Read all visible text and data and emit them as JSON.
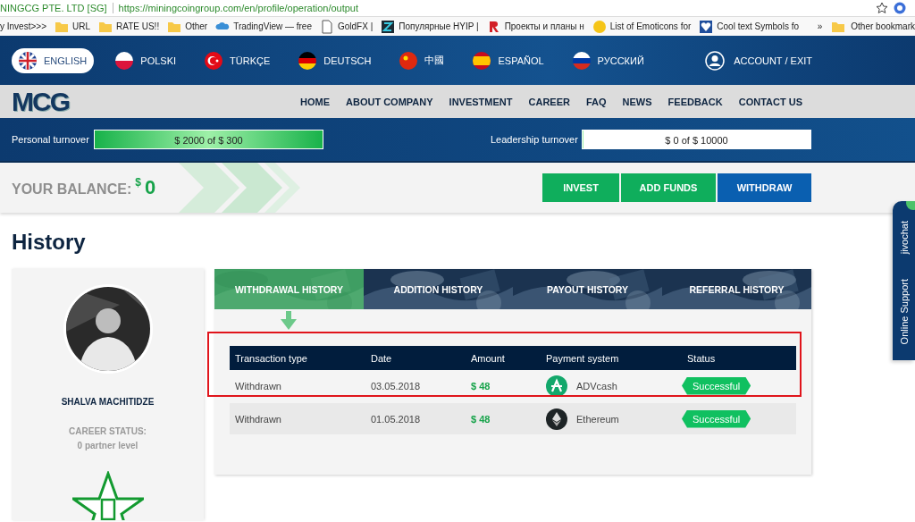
{
  "browser": {
    "tab_title": "NINGCG PTE. LTD [SG]",
    "url": "https://miningcoingroup.com/en/profile/operation/output",
    "bookmarks": [
      {
        "label": "y Invest>>>",
        "kind": "none"
      },
      {
        "label": "URL",
        "kind": "folder"
      },
      {
        "label": "RATE US!!",
        "kind": "folder"
      },
      {
        "label": "Other",
        "kind": "folder"
      },
      {
        "label": "TradingView — free",
        "kind": "cloud"
      },
      {
        "label": "GoldFX |",
        "kind": "page"
      },
      {
        "label": "Популярные HYIP |",
        "kind": "square"
      },
      {
        "label": "Проекты и планы н",
        "kind": "mark"
      },
      {
        "label": "List of Emoticons for",
        "kind": "emoji"
      },
      {
        "label": "Cool text Symbols fo",
        "kind": "heart"
      }
    ],
    "overflow": "»",
    "other_bookmarks": "Other bookmark"
  },
  "languages": [
    {
      "label": "ENGLISH",
      "kind": "uk",
      "selected": true
    },
    {
      "label": "POLSKI",
      "kind": "pl",
      "selected": false
    },
    {
      "label": "TÜRKÇE",
      "kind": "tr",
      "selected": false
    },
    {
      "label": "DEUTSCH",
      "kind": "de",
      "selected": false
    },
    {
      "label": "中國",
      "kind": "cn",
      "selected": false
    },
    {
      "label": "ESPAÑOL",
      "kind": "es",
      "selected": false
    },
    {
      "label": "РУССКИЙ",
      "kind": "ru",
      "selected": false
    }
  ],
  "account": "ACCOUNT / EXIT",
  "logo": "MCG",
  "nav": [
    "HOME",
    "ABOUT COMPANY",
    "INVESTMENT",
    "CAREER",
    "FAQ",
    "NEWS",
    "FEEDBACK",
    "CONTACT US"
  ],
  "turnover": [
    {
      "label": "Personal turnover",
      "reading": "$ 2000 of $ 300",
      "level": 1
    },
    {
      "label": "Leadership turnover",
      "reading": "$ 0 of $ 10000",
      "level": 0
    }
  ],
  "balance": {
    "label": "YOUR BALANCE:",
    "currency": "$",
    "amount": "0"
  },
  "actions": [
    {
      "label": "INVEST",
      "color": "#0fae5c"
    },
    {
      "label": "ADD FUNDS",
      "color": "#0fae5c"
    },
    {
      "label": "WITHDRAW",
      "color": "#0a5fb0"
    }
  ],
  "page_title": "History",
  "profile": {
    "name": "SHALVA MACHITIDZE",
    "status_label": "CAREER STATUS:",
    "status_value": "0 partner level"
  },
  "tabs": [
    {
      "label": "WITHDRAWAL HISTORY",
      "selected": true
    },
    {
      "label": "ADDITION HISTORY",
      "selected": false
    },
    {
      "label": "PAYOUT HISTORY",
      "selected": false
    },
    {
      "label": "REFERRAL HISTORY",
      "selected": false
    }
  ],
  "table": {
    "columns": [
      "Transaction type",
      "Date",
      "Amount",
      "Payment system",
      "Status"
    ],
    "rows": [
      {
        "type": "Withdrawn",
        "date": "03.05.2018",
        "amount": "$ 48",
        "payment": "ADVcash",
        "kind": "advcash",
        "status": "Successful",
        "outlined": true
      },
      {
        "type": "Withdrawn",
        "date": "01.05.2018",
        "amount": "$ 48",
        "payment": "Ethereum",
        "kind": "ethereum",
        "status": "Successful",
        "outlined": false
      }
    ]
  },
  "chat": [
    "jivochat",
    "Online Support"
  ]
}
